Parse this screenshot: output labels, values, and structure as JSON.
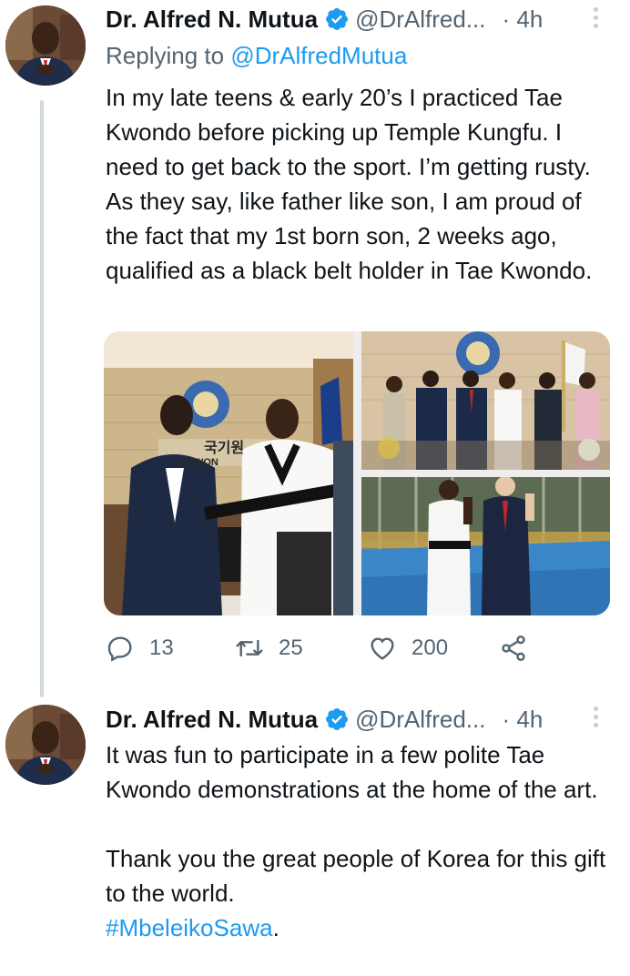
{
  "tweets": [
    {
      "author_name": "Dr. Alfred N. Mutua",
      "handle": "@DrAlfred...",
      "time": "· 4h",
      "replying_prefix": "Replying to",
      "replying_to": "@DrAlfredMutua",
      "text": "In my late teens & early 20’s I practiced Tae Kwondo before picking up Temple Kungfu. I need to get back to the sport. I’m getting rusty. As they say, like father like son, I am proud of the fact that my 1st born son, 2 weeks ago, qualified as a black belt holder in Tae Kwondo.",
      "media": [
        {
          "icon": "photo-belt-ceremony",
          "sign_text": "KKIWON",
          "sign_korean": "국기원"
        },
        {
          "icon": "photo-group-pose"
        },
        {
          "icon": "photo-outdoor-pose"
        }
      ],
      "actions": {
        "replies": "13",
        "retweets": "25",
        "likes": "200"
      }
    },
    {
      "author_name": "Dr. Alfred N. Mutua",
      "handle": "@DrAlfred...",
      "time": "· 4h",
      "text_p1": "It was fun to participate in a few polite Tae Kwondo demonstrations at the home of the art.",
      "text_p2": "Thank you the great people of Korea for this gift to the world.",
      "hashtag": "#MbeleikoSawa",
      "hashtag_suffix": "."
    }
  ],
  "colors": {
    "accent": "#1d9bf0",
    "secondary_text": "#536471",
    "thread_line": "#cfd9de"
  }
}
